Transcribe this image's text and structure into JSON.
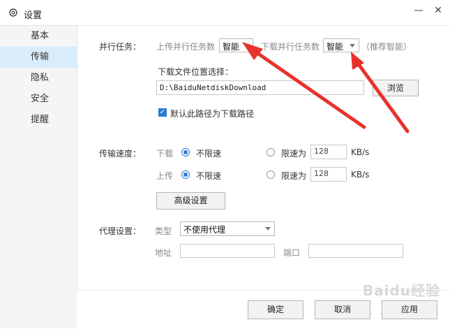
{
  "window": {
    "title": "设置",
    "minimize": "—",
    "close": "✕"
  },
  "sidebar": {
    "items": [
      {
        "label": "基本",
        "active": false
      },
      {
        "label": "传输",
        "active": true
      },
      {
        "label": "隐私",
        "active": false
      },
      {
        "label": "安全",
        "active": false
      },
      {
        "label": "提醒",
        "active": false
      }
    ]
  },
  "parallel": {
    "section_label": "并行任务：",
    "upload_label": "上传并行任务数",
    "upload_value": "智能",
    "download_label": "下载并行任务数",
    "download_value": "智能",
    "hint": "（推荐智能）"
  },
  "location": {
    "label": "下载文件位置选择：",
    "path": "D:\\BaiduNetdiskDownload",
    "browse": "浏览",
    "default_checkbox": "默认此路径为下载路径",
    "default_checked": true
  },
  "speed": {
    "section_label": "传输速度：",
    "download_label": "下载",
    "upload_label": "上传",
    "unlimited": "不限速",
    "limit": "限速为",
    "download_limit_value": "128",
    "upload_limit_value": "128",
    "unit": "KB/s",
    "advanced": "高级设置"
  },
  "proxy": {
    "section_label": "代理设置：",
    "type_label": "类型",
    "type_value": "不使用代理",
    "address_label": "地址",
    "port_label": "端口"
  },
  "footer": {
    "ok": "确定",
    "cancel": "取消",
    "apply": "应用"
  },
  "watermark": "Baidu经验",
  "colors": {
    "accent": "#2a7ad4",
    "sidebar_active": "#d9ecfb",
    "annotation_arrow": "#e8322c"
  }
}
